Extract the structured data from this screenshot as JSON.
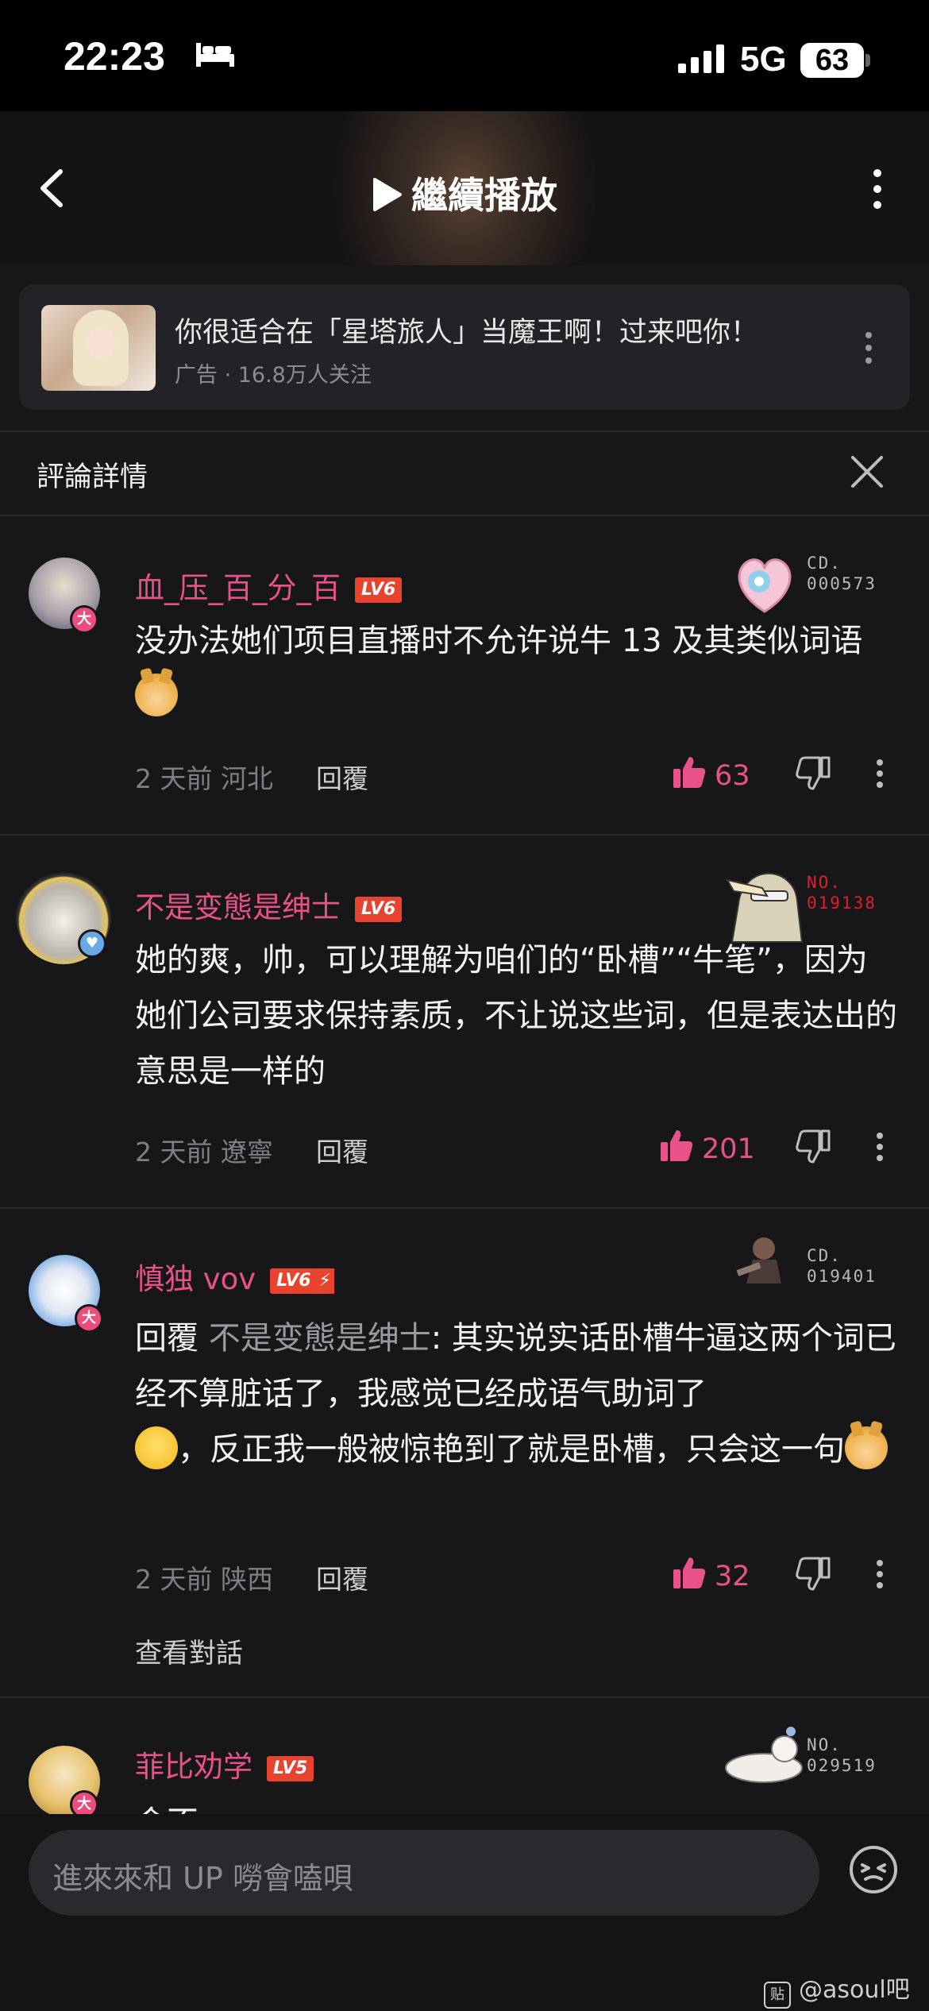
{
  "status_bar": {
    "time": "22:23",
    "network": "5G",
    "battery": "63"
  },
  "header": {
    "title": "繼續播放"
  },
  "ad": {
    "title": "你很适合在「星塔旅人」当魔王啊！过来吧你！",
    "meta": "广告 · 16.8万人关注"
  },
  "detail": {
    "title": "評論詳情"
  },
  "comments": [
    {
      "username": "血_压_百_分_百",
      "level": "LV6",
      "deco_label": "CD.",
      "deco_no": "000573",
      "text": "没办法她们项目直播时不允许说牛 13 及其类似词语",
      "date": "2 天前  河北",
      "reply_label": "回覆",
      "likes": "63"
    },
    {
      "username": "不是变態是绅士",
      "level": "LV6",
      "deco_label": "NO.",
      "deco_no": "019138",
      "text": "她的爽，帅，可以理解为咱们的“卧槽”“牛笔”，因为她们公司要求保持素质，不让说这些词，但是表达出的意思是一样的",
      "date": "2 天前  遼寧",
      "reply_label": "回覆",
      "likes": "201"
    },
    {
      "username": "慎独 vov",
      "level": "LV6",
      "deco_label": "CD.",
      "deco_no": "019401",
      "reply_prefix": "回覆",
      "reply_to": "不是变態是绅士",
      "text_a": ": 其实说实话卧槽牛逼这两个词已经不算脏话了，我感觉已经成语气助词了",
      "text_b": "，反正我一般被惊艳到了就是卧槽，只会这一句",
      "date": "2 天前  陕西",
      "reply_label": "回覆",
      "likes": "32",
      "view_conversation": "查看對話"
    },
    {
      "username": "菲比劝学",
      "level": "LV5",
      "deco_label": "NO.",
      "deco_no": "029519",
      "text_partial": "会不"
    }
  ],
  "badge_da": "大",
  "input": {
    "placeholder": "進來來和 UP 嘮會嗑唄"
  },
  "watermark": {
    "icon_text": "贴",
    "text": "@asoul吧"
  },
  "colors": {
    "accent_pink": "#e8518a",
    "level_red": "#e8432f",
    "background": "#17171a"
  }
}
